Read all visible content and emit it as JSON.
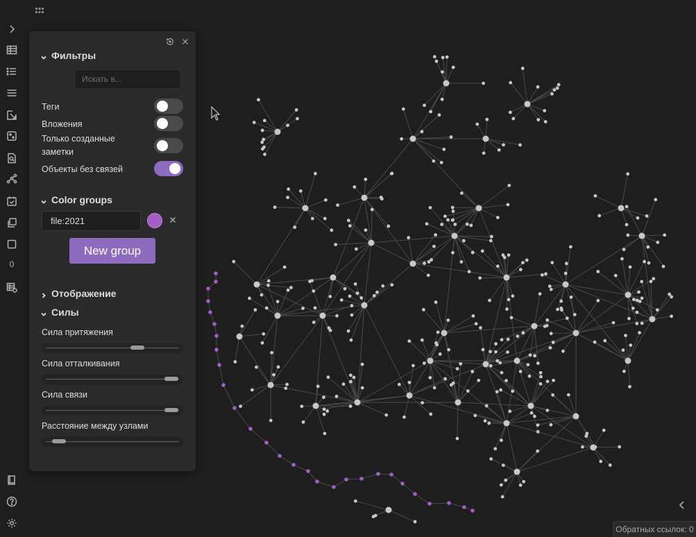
{
  "ribbon": {
    "icons": [
      "expand-icon",
      "table-icon",
      "bullet-list-icon",
      "menu-icon",
      "open-link-icon",
      "dice-icon",
      "file-search-icon",
      "graph-icon",
      "calendar-check-icon",
      "copy-icon",
      "square-icon",
      "counter",
      "table-plus-icon",
      "book-icon",
      "help-icon",
      "settings-icon"
    ],
    "counter": "0"
  },
  "panel": {
    "filters": {
      "title": "Фильтры",
      "search_placeholder": "Искать в...",
      "tags_label": "Теги",
      "tags_on": false,
      "attachments_label": "Вложения",
      "attachments_on": false,
      "existing_only_label_line1": "Только созданные",
      "existing_only_label_line2": "заметки",
      "existing_only_on": false,
      "orphans_label": "Объекты без связей",
      "orphans_on": true
    },
    "color_groups": {
      "title": "Color groups",
      "query": "file:2021",
      "color": "#a35fc5",
      "new_group_label": "New group"
    },
    "display": {
      "title": "Отображение"
    },
    "forces": {
      "title": "Силы",
      "center_label": "Сила притяжения",
      "center_value": 0.7,
      "repel_label": "Сила отталкивания",
      "repel_value": 0.97,
      "link_label": "Сила связи",
      "link_value": 0.97,
      "distance_label": "Расстояние между узлами",
      "distance_value": 0.07
    }
  },
  "graph": {
    "node_color": "#c8c8c8",
    "highlight_color": "#a35fc5",
    "link_color": "#4a4a4a"
  },
  "backlinks": {
    "label": "Обратных ссылок: 0"
  }
}
